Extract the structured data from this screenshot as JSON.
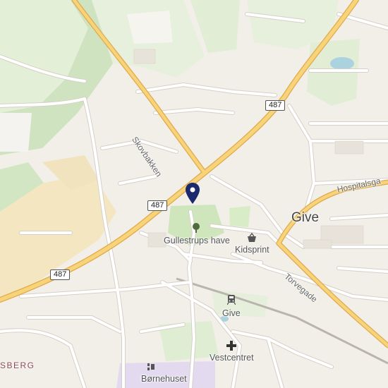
{
  "map": {
    "colors": {
      "background": "#f2efe9",
      "park": "#d6e9c7",
      "forest": "#cfe3c0",
      "field": "#eaf2e0",
      "industrial": "#f4e6c0",
      "school": "#e4daf0",
      "water": "#aad3df",
      "major_road": "#f4c560",
      "minor_road": "#ffffff",
      "rail": "#b9b5ad",
      "marker": "#1a2a6c"
    },
    "labels": {
      "town": "Give",
      "park": "Gullestrups have",
      "shop": "Kidsprint",
      "station": "Give",
      "health": "Vestcentret",
      "kindergarten": "Børnehuset",
      "district": "SBERG"
    },
    "streets": {
      "skovbakken": "Skovbakken",
      "hospitalsgade": "Hospitalsga",
      "torvegade": "Torvegade"
    },
    "road_shields": [
      "487",
      "487",
      "487"
    ],
    "icons": {
      "marker": "location-pin",
      "park": "tree-icon",
      "shop": "shopping-basket-icon",
      "station": "train-icon",
      "health": "cross-icon",
      "kindergarten": "kindergarten-icon"
    }
  }
}
